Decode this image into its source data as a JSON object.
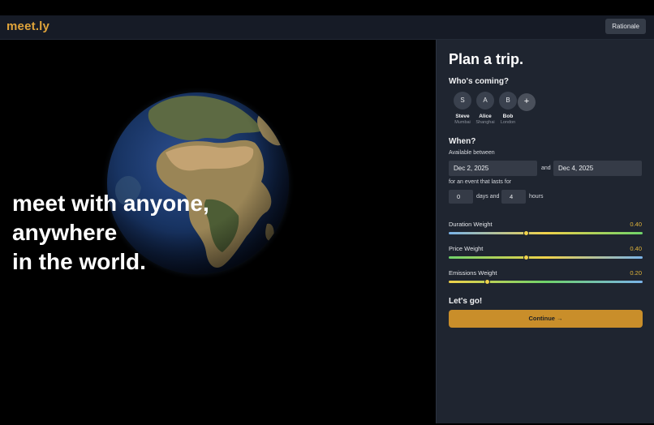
{
  "header": {
    "logo": "meet.ly",
    "rationale_label": "Rationale"
  },
  "hero": {
    "lines": [
      "meet with anyone,",
      "anywhere",
      "in the world."
    ]
  },
  "panel": {
    "title": "Plan a trip.",
    "whos_coming": "Who's coming?",
    "people": [
      {
        "initial": "S",
        "name": "Steve",
        "city": "Mumbai"
      },
      {
        "initial": "A",
        "name": "Alice",
        "city": "Shanghai"
      },
      {
        "initial": "B",
        "name": "Bob",
        "city": "London"
      }
    ],
    "add_label": "+",
    "when": "When?",
    "available_between": "Available between",
    "start_date": "Dec 2, 2025",
    "and_label": "and",
    "end_date": "Dec 4, 2025",
    "event_lasts": "for an event that lasts for",
    "days_value": "0",
    "days_and_label": "days and",
    "hours_value": "4",
    "hours_label": "hours",
    "weights": [
      {
        "label": "Duration Weight",
        "value_text": "0.40",
        "value": 0.4,
        "gradient": [
          "#7ab3e8",
          "#f0d24a",
          "#6fd36a"
        ]
      },
      {
        "label": "Price Weight",
        "value_text": "0.40",
        "value": 0.4,
        "gradient": [
          "#6fd36a",
          "#f0d24a",
          "#7ab3e8"
        ]
      },
      {
        "label": "Emissions Weight",
        "value_text": "0.20",
        "value": 0.2,
        "gradient": [
          "#f0d24a",
          "#6fd36a",
          "#7ab3e8"
        ]
      }
    ],
    "lets_go": "Let's go!",
    "continue_label": "Continue →"
  },
  "colors": {
    "accent": "#e0a43a",
    "button": "#c98e2a",
    "panel_bg": "#1f2530"
  }
}
